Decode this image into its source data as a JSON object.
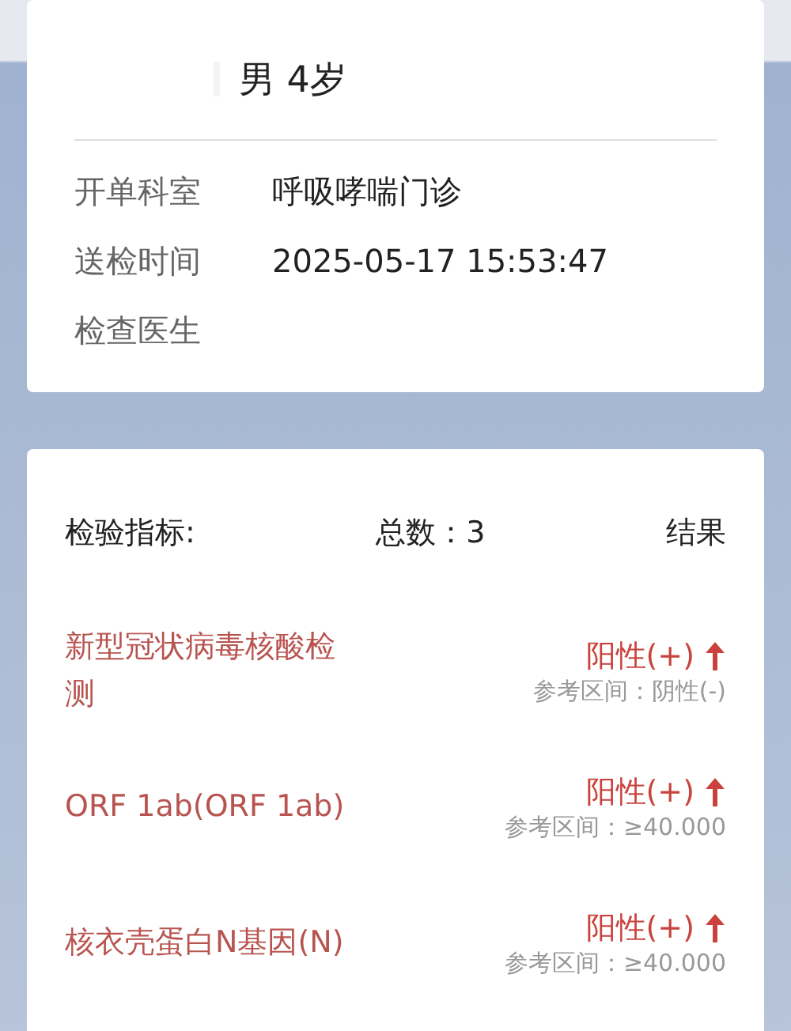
{
  "patient": {
    "sex_age": "男 4岁"
  },
  "info": [
    {
      "label": "开单科室",
      "value": "呼吸哮喘门诊"
    },
    {
      "label": "送检时间",
      "value": "2025-05-17 15:53:47"
    },
    {
      "label": "检查医生"
    }
  ],
  "results": {
    "header": {
      "indicator": "检验指标:",
      "total": "总数：3",
      "result": "结果"
    },
    "rows": [
      {
        "name": "新型冠状病毒核酸检测",
        "result": "阳性(+)",
        "elevated": true,
        "reference": "参考区间：阴性(-)"
      },
      {
        "name": "ORF 1ab(ORF 1ab)",
        "result": "阳性(+)",
        "elevated": true,
        "reference": "参考区间：≥40.000"
      },
      {
        "name": "核衣壳蛋白N基因(N)",
        "result": "阳性(+)",
        "elevated": true,
        "reference": "参考区间：≥40.000"
      }
    ]
  }
}
